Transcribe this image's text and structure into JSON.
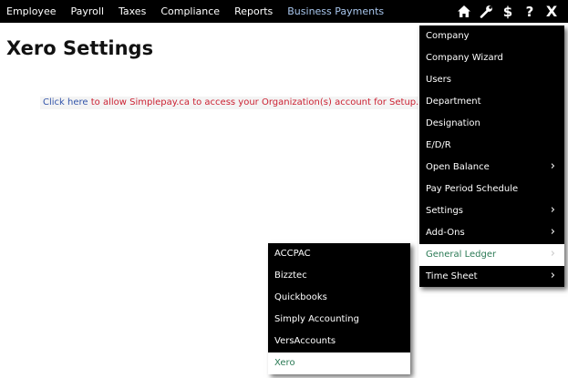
{
  "nav": {
    "items": [
      "Employee",
      "Payroll",
      "Taxes",
      "Compliance",
      "Reports",
      "Business Payments"
    ]
  },
  "icons": [
    "home-icon",
    "wrench-icon",
    "dollar-icon",
    "help-icon",
    "close-icon"
  ],
  "icon_text": {
    "dollar": "$",
    "help": "?",
    "close": "X"
  },
  "page": {
    "title": "Xero Settings"
  },
  "notice": {
    "link_text": "Click here",
    "message": " to allow Simplepay.ca to access your Organization(s) account for Setup."
  },
  "settings_menu": {
    "items": [
      {
        "label": "Company"
      },
      {
        "label": "Company Wizard"
      },
      {
        "label": "Users"
      },
      {
        "label": "Department"
      },
      {
        "label": "Designation"
      },
      {
        "label": "E/D/R"
      },
      {
        "label": "Open Balance",
        "submenu": true
      },
      {
        "label": "Pay Period Schedule"
      },
      {
        "label": "Settings",
        "submenu": true
      },
      {
        "label": "Add-Ons",
        "submenu": true
      },
      {
        "label": "General Ledger",
        "submenu": true,
        "active": true
      },
      {
        "label": "Time Sheet",
        "submenu": true
      }
    ]
  },
  "gl_submenu": {
    "items": [
      {
        "label": "ACCPAC"
      },
      {
        "label": "Bizztec"
      },
      {
        "label": "Quickbooks"
      },
      {
        "label": "Simply Accounting"
      },
      {
        "label": "VersAccounts"
      },
      {
        "label": "Xero",
        "active": true
      }
    ]
  },
  "colors": {
    "bar": "#000000",
    "business_payments": "#a9c7ee",
    "link": "#3355aa",
    "message": "#cc2233",
    "active_item_text": "#2b7a55"
  }
}
